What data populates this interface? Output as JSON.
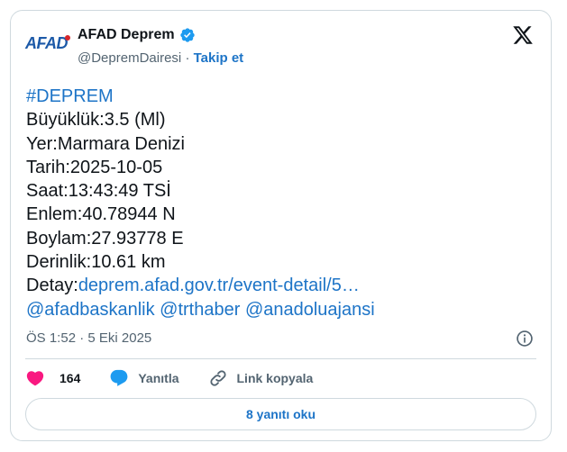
{
  "author": {
    "logo_text": "AFAD",
    "name": "AFAD Deprem",
    "handle": "@DepremDairesi",
    "separator": "·",
    "follow_label": "Takip et"
  },
  "post": {
    "hashtag": "#DEPREM",
    "lines": [
      "Büyüklük:3.5 (Ml)",
      "Yer:Marmara Denizi",
      "Tarih:2025-10-05",
      "Saat:13:43:49 TSİ",
      "Enlem:40.78944 N",
      "Boylam:27.93778 E",
      "Derinlik:10.61 km"
    ],
    "detail_label": "Detay:",
    "detail_link": "deprem.afad.gov.tr/event-detail/5…",
    "mentions": "@afadbaskanlik @trthaber @anadoluajansi",
    "timestamp": "ÖS 1:52 · 5 Eki 2025"
  },
  "actions": {
    "like_count": "164",
    "reply_label": "Yanıtla",
    "copy_link_label": "Link kopyala"
  },
  "read_replies_label": "8 yanıtı oku",
  "colors": {
    "link": "#1d74c7",
    "like": "#f91880",
    "verified": "#1d9bf0",
    "brand": "#1d5aa8"
  },
  "icons": [
    "verified-badge-icon",
    "x-logo-icon",
    "info-icon",
    "heart-icon",
    "reply-bubble-icon",
    "link-icon"
  ]
}
